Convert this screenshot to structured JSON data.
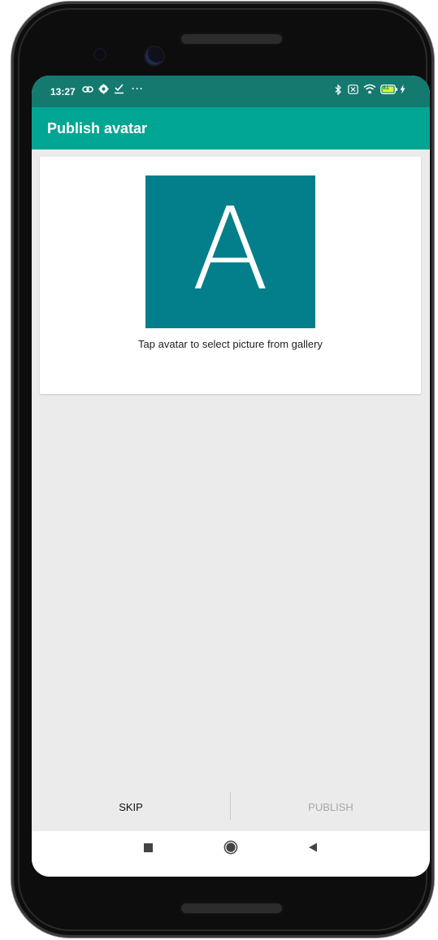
{
  "status_bar": {
    "time": "13:27",
    "left_icons": [
      "link-icon",
      "gear-icon",
      "download-done-icon",
      "more-icon"
    ],
    "right_icons": [
      "bluetooth-icon",
      "sim-icon",
      "wifi-icon",
      "battery-icon",
      "charging-icon"
    ],
    "battery_level": "81"
  },
  "app_bar": {
    "title": "Publish avatar"
  },
  "avatar": {
    "letter": "A",
    "background": "#027f8b"
  },
  "hint_text": "Tap avatar to select picture from gallery",
  "actions": {
    "skip_label": "SKIP",
    "publish_label": "PUBLISH"
  },
  "colors": {
    "status_bar": "#147a6f",
    "app_bar": "#00a693",
    "background": "#ebebeb"
  },
  "nav": {
    "icons": [
      "recents-square-icon",
      "home-circle-icon",
      "back-triangle-icon"
    ]
  }
}
